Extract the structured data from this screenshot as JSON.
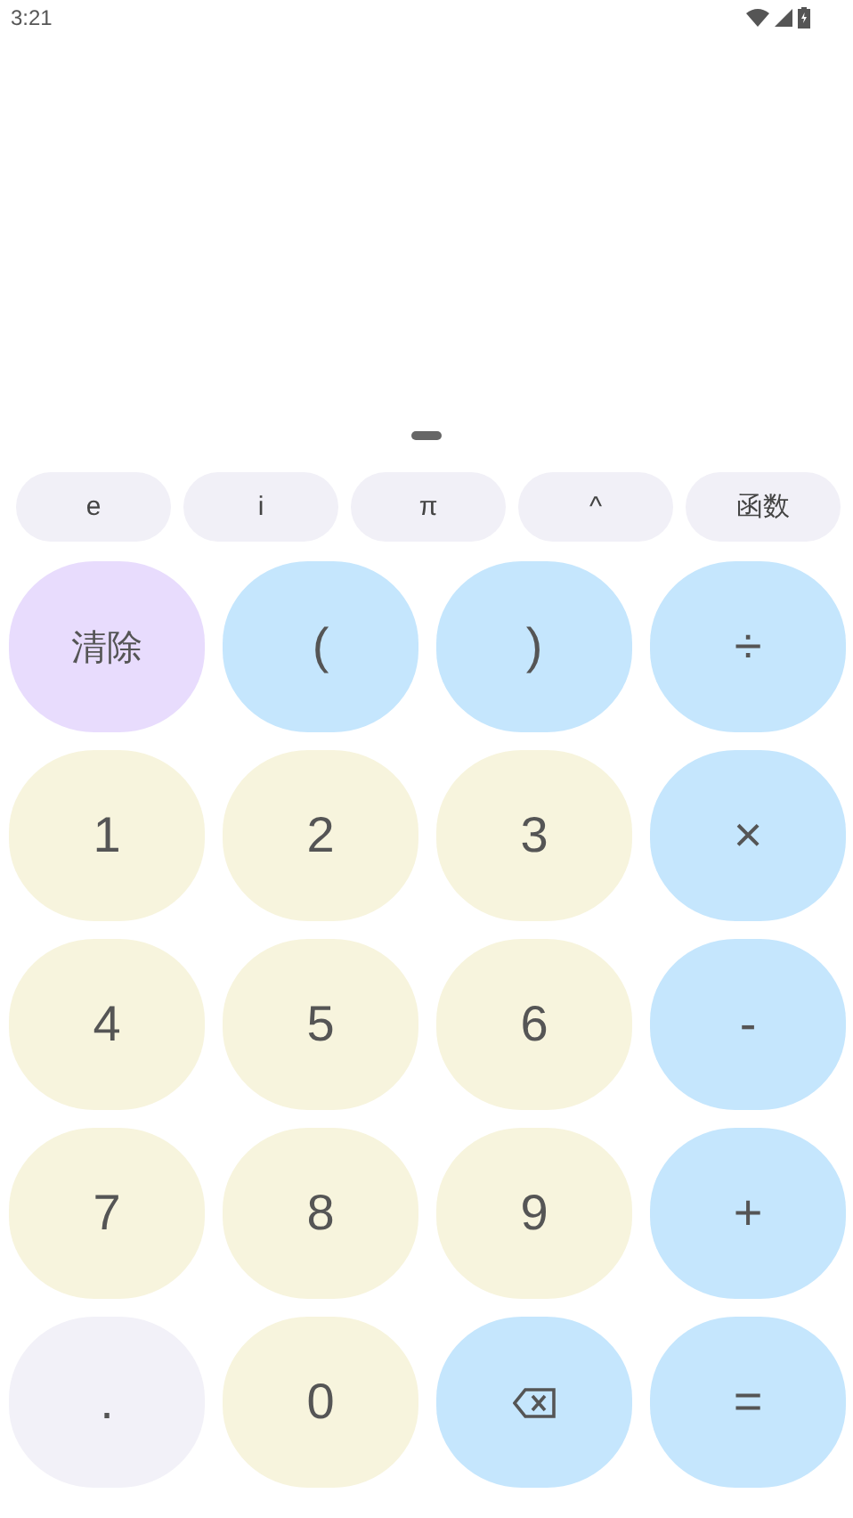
{
  "status_bar": {
    "time": "3:21"
  },
  "function_keys": [
    {
      "label": "e"
    },
    {
      "label": "i"
    },
    {
      "label": "π"
    },
    {
      "label": "^"
    },
    {
      "label": "函数"
    }
  ],
  "keys": [
    {
      "kind": "clear",
      "label": "清除"
    },
    {
      "kind": "operator",
      "label": "("
    },
    {
      "kind": "operator",
      "label": ")"
    },
    {
      "kind": "operator",
      "label": "÷"
    },
    {
      "kind": "digit",
      "label": "1"
    },
    {
      "kind": "digit",
      "label": "2"
    },
    {
      "kind": "digit",
      "label": "3"
    },
    {
      "kind": "operator",
      "label": "×"
    },
    {
      "kind": "digit",
      "label": "4"
    },
    {
      "kind": "digit",
      "label": "5"
    },
    {
      "kind": "digit",
      "label": "6"
    },
    {
      "kind": "operator",
      "label": "-"
    },
    {
      "kind": "digit",
      "label": "7"
    },
    {
      "kind": "digit",
      "label": "8"
    },
    {
      "kind": "digit",
      "label": "9"
    },
    {
      "kind": "operator",
      "label": "+"
    },
    {
      "kind": "point",
      "label": "."
    },
    {
      "kind": "digit",
      "label": "0"
    },
    {
      "kind": "backspace"
    },
    {
      "kind": "operator",
      "label": "="
    }
  ]
}
